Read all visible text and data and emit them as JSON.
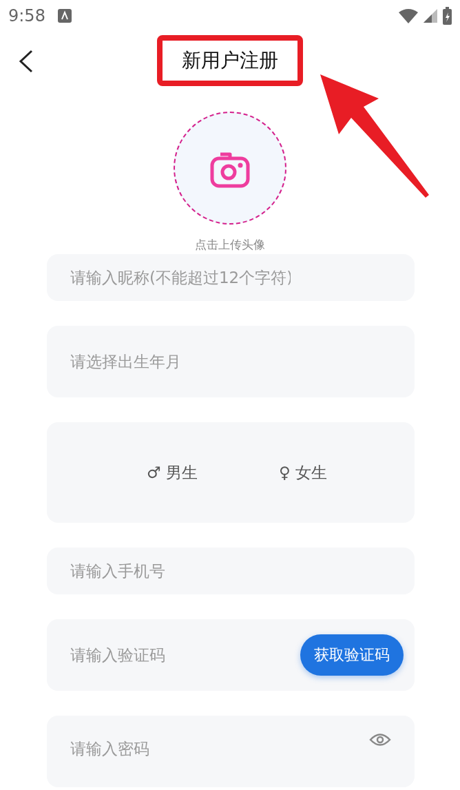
{
  "status_bar": {
    "time": "9:58"
  },
  "header": {
    "title": "新用户注册",
    "highlighted": true
  },
  "avatar": {
    "caption": "点击上传头像"
  },
  "fields": [
    {
      "kind": "input",
      "placeholder": "请输入昵称(不能超过12个字符)"
    },
    {
      "kind": "picker",
      "placeholder": "请选择出生年月"
    },
    {
      "kind": "gender",
      "options": [
        {
          "symbol": "♂",
          "label": "男生"
        },
        {
          "symbol": "♀",
          "label": "女生"
        }
      ]
    },
    {
      "kind": "input",
      "placeholder": "请输入手机号"
    },
    {
      "kind": "code",
      "placeholder": "请输入验证码",
      "button": "获取验证码"
    },
    {
      "kind": "password",
      "placeholder": "请输入密码"
    }
  ]
}
